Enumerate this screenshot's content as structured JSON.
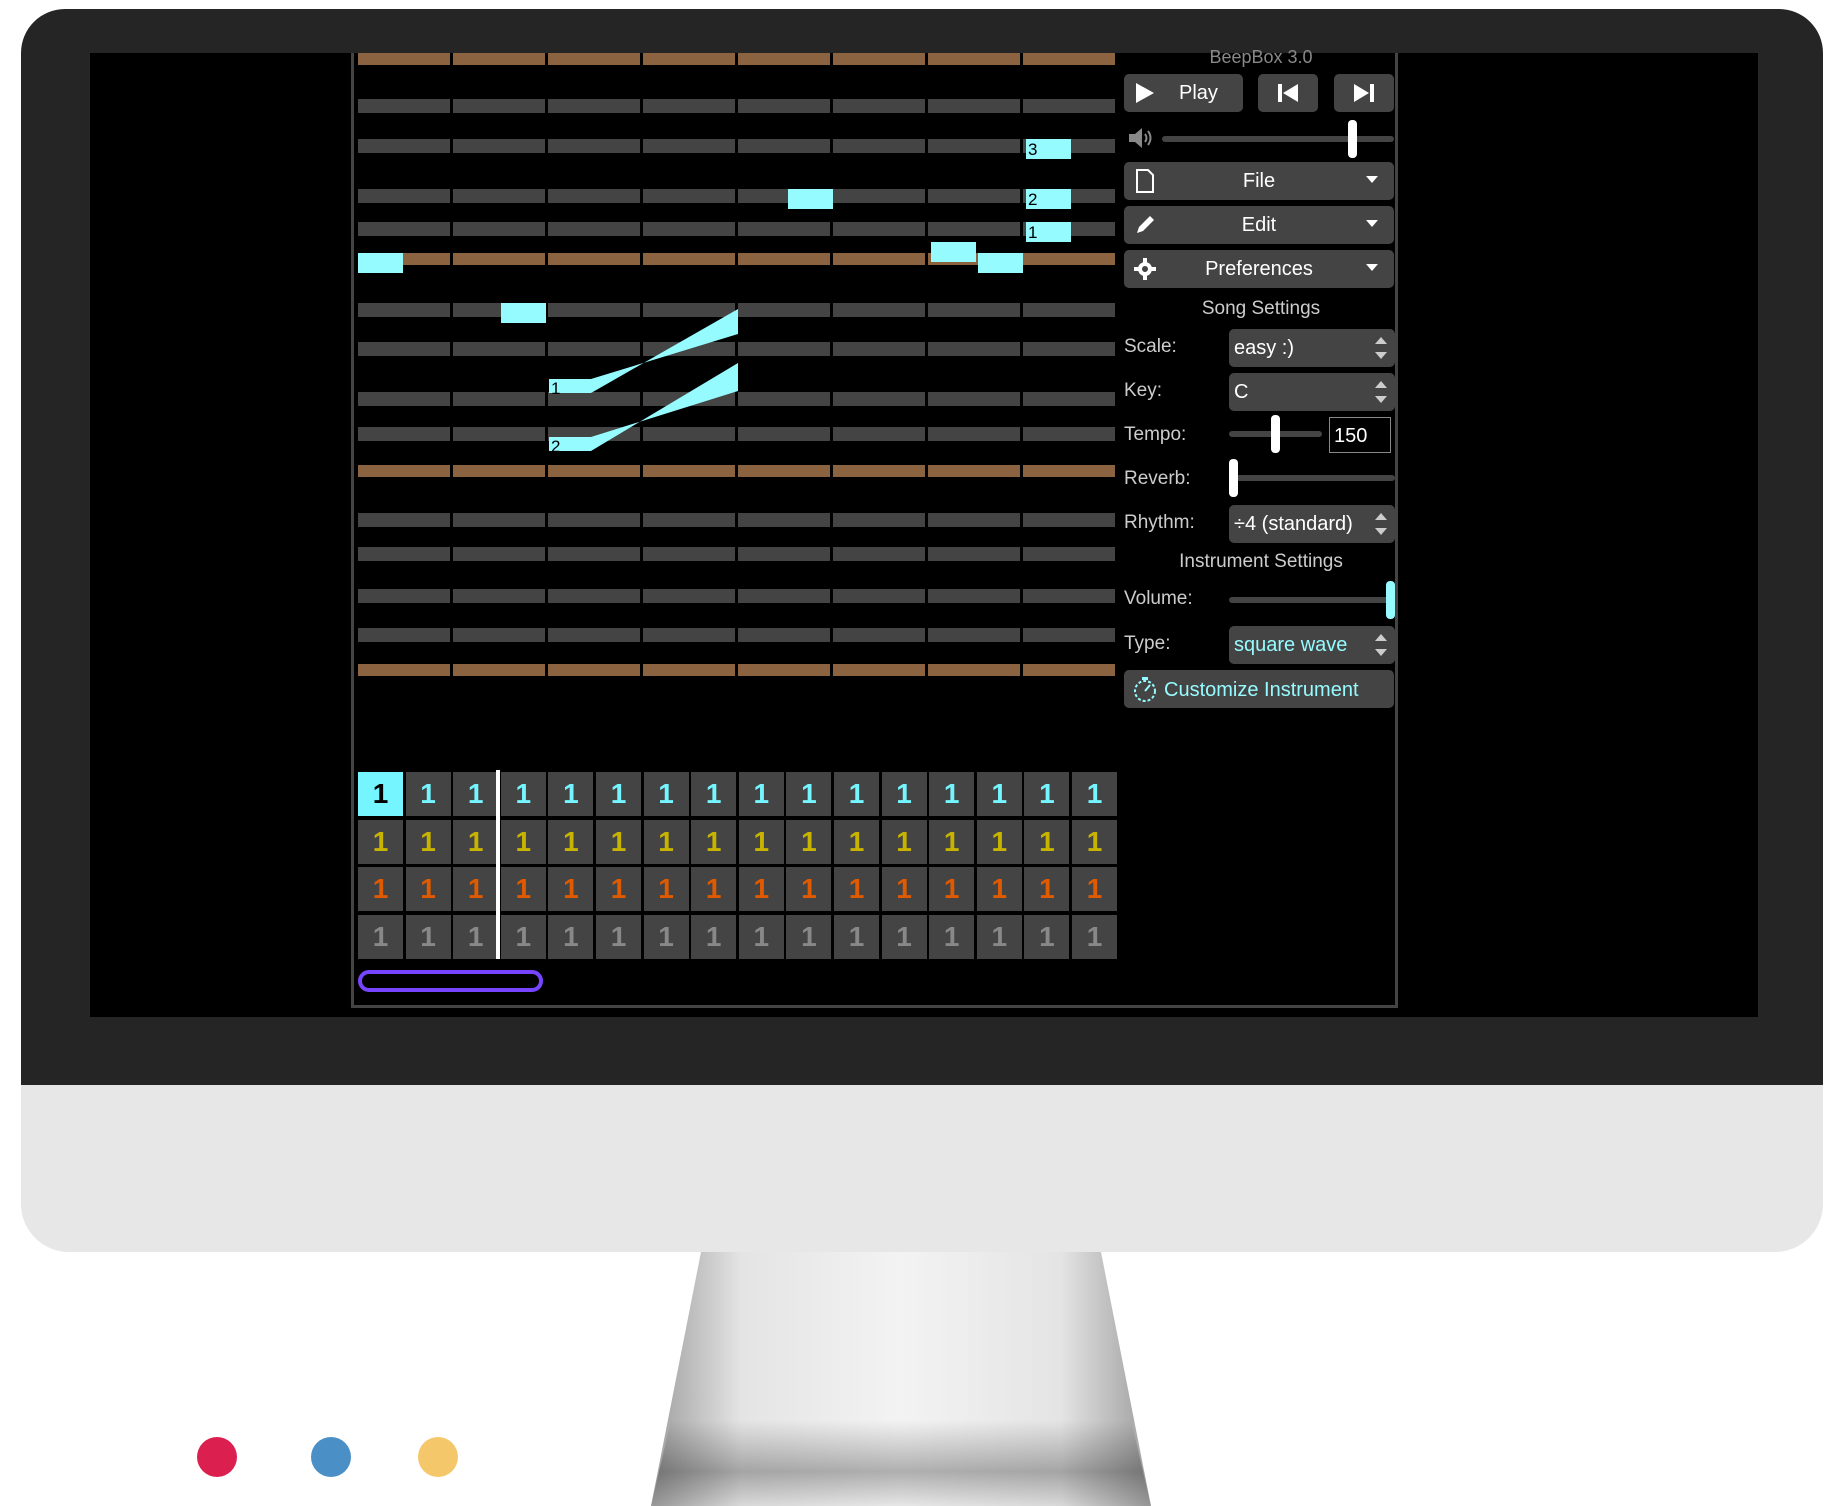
{
  "app": {
    "title": "BeepBox 3.0",
    "transport": {
      "play_label": "Play"
    },
    "volume": {
      "level": 0.82
    },
    "menus": [
      {
        "label": "File",
        "icon": "document-icon"
      },
      {
        "label": "Edit",
        "icon": "pencil-icon"
      },
      {
        "label": "Preferences",
        "icon": "gear-icon"
      }
    ],
    "song_settings": {
      "heading": "Song Settings",
      "scale": {
        "label": "Scale:",
        "value": "easy :)"
      },
      "key": {
        "label": "Key:",
        "value": "C"
      },
      "tempo": {
        "label": "Tempo:",
        "value": "150",
        "slider_level": 0.5
      },
      "reverb": {
        "label": "Reverb:",
        "level": 0.0
      },
      "rhythm": {
        "label": "Rhythm:",
        "value": "÷4 (standard)"
      }
    },
    "instrument_settings": {
      "heading": "Instrument Settings",
      "volume": {
        "label": "Volume:",
        "level": 1.0
      },
      "type": {
        "label": "Type:",
        "value": "square wave"
      },
      "customize_label": "Customize Instrument"
    },
    "note_labels": [
      "3",
      "2",
      "1",
      "1",
      "2"
    ],
    "pattern_grid": {
      "rows": [
        {
          "color": "#74f5ff",
          "values": [
            "1",
            "1",
            "1",
            "1",
            "1",
            "1",
            "1",
            "1",
            "1",
            "1",
            "1",
            "1",
            "1",
            "1",
            "1",
            "1"
          ]
        },
        {
          "color": "#c8b400",
          "values": [
            "1",
            "1",
            "1",
            "1",
            "1",
            "1",
            "1",
            "1",
            "1",
            "1",
            "1",
            "1",
            "1",
            "1",
            "1",
            "1"
          ]
        },
        {
          "color": "#e05a00",
          "values": [
            "1",
            "1",
            "1",
            "1",
            "1",
            "1",
            "1",
            "1",
            "1",
            "1",
            "1",
            "1",
            "1",
            "1",
            "1",
            "1"
          ]
        },
        {
          "color": "#888888",
          "values": [
            "1",
            "1",
            "1",
            "1",
            "1",
            "1",
            "1",
            "1",
            "1",
            "1",
            "1",
            "1",
            "1",
            "1",
            "1",
            "1"
          ]
        }
      ]
    },
    "colors": {
      "note": "#96fbff",
      "tonic_row": "#8b6340",
      "scale_row": "#444444",
      "loop": "#7744ff"
    }
  },
  "decor_dots": [
    "#db2050",
    "#4a90c6",
    "#f5c76b"
  ]
}
